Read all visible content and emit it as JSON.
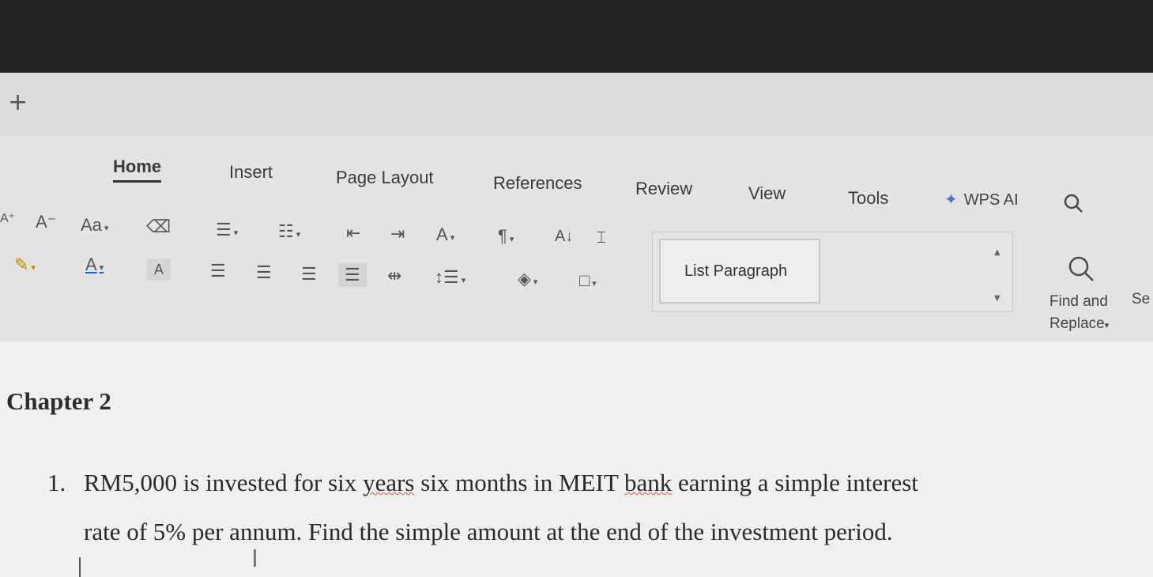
{
  "tabbar": {
    "new_tab_glyph": "+"
  },
  "menu": {
    "tabs": [
      {
        "label": "Home",
        "active": true
      },
      {
        "label": "Insert"
      },
      {
        "label": "Page Layout"
      },
      {
        "label": "References"
      },
      {
        "label": "Review"
      },
      {
        "label": "View"
      },
      {
        "label": "Tools"
      }
    ],
    "wps_ai": "WPS AI"
  },
  "ribbon": {
    "font_case_label": "Aa",
    "style_gallery": {
      "current_style": "List Paragraph"
    },
    "find_replace_label_1": "Find and",
    "find_replace_label_2": "Replace",
    "select_cut_label": "Se"
  },
  "document": {
    "chapter_title": "Chapter 2",
    "item_number": "1.",
    "line1_a": "RM5,000 is invested for six ",
    "line1_b": "years",
    "line1_c": " six months in MEIT ",
    "line1_d": "bank",
    "line1_e": " earning a simple interest",
    "line2": "rate of 5% per annum. Find the simple amount at the end of the investment period."
  },
  "colors": {
    "accent": "#4a6fd1",
    "spellcheck": "#d9534f"
  }
}
